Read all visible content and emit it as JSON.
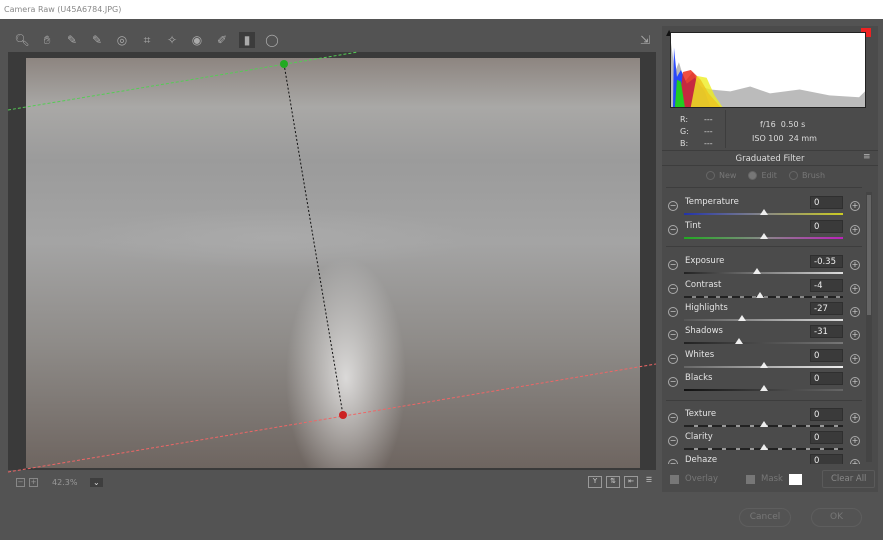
{
  "window": {
    "title": "Camera Raw (U45A6784.JPG)"
  },
  "toolbar": {
    "tools": [
      "zoom-icon",
      "hand-icon",
      "white-balance-icon",
      "color-sampler-icon",
      "targeted-adjustment-icon",
      "crop-icon",
      "spot-removal-icon",
      "red-eye-icon",
      "adjustment-brush-icon",
      "graduated-filter-icon",
      "radial-filter-icon"
    ],
    "active": "graduated-filter-icon",
    "open_icon": "open-in-icon"
  },
  "status": {
    "zoom": "42.3%"
  },
  "info": {
    "r_label": "R:",
    "g_label": "G:",
    "b_label": "B:",
    "r": "---",
    "g": "---",
    "b": "---",
    "aperture": "f/16",
    "shutter": "0.50 s",
    "iso": "ISO 100",
    "focal": "24 mm"
  },
  "filter": {
    "title": "Graduated Filter",
    "modes": [
      "New",
      "Edit",
      "Brush"
    ],
    "selected_mode": "Edit",
    "sliders": [
      {
        "label": "Temperature",
        "value": "0",
        "min": -100,
        "max": 100,
        "track": "linear-gradient(90deg,#2233aa,#888,#cccc22)"
      },
      {
        "label": "Tint",
        "value": "0",
        "min": -100,
        "max": 100,
        "track": "linear-gradient(90deg,#22aa22,#888,#bb22bb)"
      },
      {
        "label": "Exposure",
        "value": "-0.35",
        "min": -4,
        "max": 4,
        "track": "linear-gradient(90deg,#222,#ddd)"
      },
      {
        "label": "Contrast",
        "value": "-4",
        "min": -100,
        "max": 100,
        "track": "repeating-linear-gradient(90deg,#222 0 8px,#888 8px 12px)"
      },
      {
        "label": "Highlights",
        "value": "-27",
        "min": -100,
        "max": 100,
        "track": "linear-gradient(90deg,#555,#ddd)"
      },
      {
        "label": "Shadows",
        "value": "-31",
        "min": -100,
        "max": 100,
        "track": "linear-gradient(90deg,#222,#777)"
      },
      {
        "label": "Whites",
        "value": "0",
        "min": -100,
        "max": 100,
        "track": "linear-gradient(90deg,#666,#eee)"
      },
      {
        "label": "Blacks",
        "value": "0",
        "min": -100,
        "max": 100,
        "track": "linear-gradient(90deg,#111,#666)"
      },
      {
        "label": "Texture",
        "value": "0",
        "min": -100,
        "max": 100,
        "track": "repeating-linear-gradient(90deg,#222 0 10px,#999 10px 14px)"
      },
      {
        "label": "Clarity",
        "value": "0",
        "min": -100,
        "max": 100,
        "track": "repeating-linear-gradient(90deg,#222 0 10px,#999 10px 14px)"
      },
      {
        "label": "Dehaze",
        "value": "0",
        "min": -100,
        "max": 100,
        "track": "linear-gradient(90deg,#888,#222)"
      }
    ],
    "overlay_label": "Overlay",
    "mask_label": "Mask",
    "mask_color": "#ffffff",
    "clear_all": "Clear All"
  },
  "dialog": {
    "cancel": "Cancel",
    "ok": "OK"
  }
}
